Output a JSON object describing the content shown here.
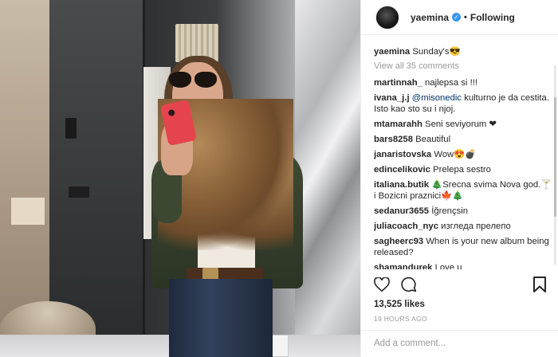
{
  "post": {
    "username": "yaemina",
    "follow_label": "Following",
    "caption_user": "yaemina",
    "caption_text": "Sunday's",
    "view_all": "View all 35 comments",
    "likes": "13,525 likes",
    "time": "19 HOURS AGO",
    "add_comment_placeholder": "Add a comment..."
  },
  "comments": [
    {
      "user": "martinnah_",
      "text": "najlepsa si !!!"
    },
    {
      "user": "ivana_j.j",
      "mention": "@misonedic",
      "text": "kulturno je da cestita. Isto kao sto su i njoj."
    },
    {
      "user": "mtamarahh",
      "text": "Seni seviyorum ❤"
    },
    {
      "user": "bars8258",
      "text": "Beautiful"
    },
    {
      "user": "janaristovska",
      "text": "Wow😍💣"
    },
    {
      "user": "edincelikovic",
      "text": "Prelepa sestro"
    },
    {
      "user": "italiana.butik",
      "text": "🎄Srecna svima Nova god.🍸 i Bozicni praznici🍁🎄"
    },
    {
      "user": "sedanur3655",
      "text": "İğrençsin"
    },
    {
      "user": "juliacoach_nyc",
      "text": "изгледа прелепо"
    },
    {
      "user": "sagheerc93",
      "text": "When is your new album being released?"
    },
    {
      "user": "shamandurek",
      "text": "Love u"
    }
  ],
  "icons": {
    "caption_emoji": "😎",
    "heart": "heart-icon",
    "comment": "comment-icon",
    "bookmark": "bookmark-icon",
    "verified": "verified-badge-icon"
  },
  "colors": {
    "accent_blue": "#3897f0",
    "mention": "#003569",
    "muted": "#999999"
  }
}
